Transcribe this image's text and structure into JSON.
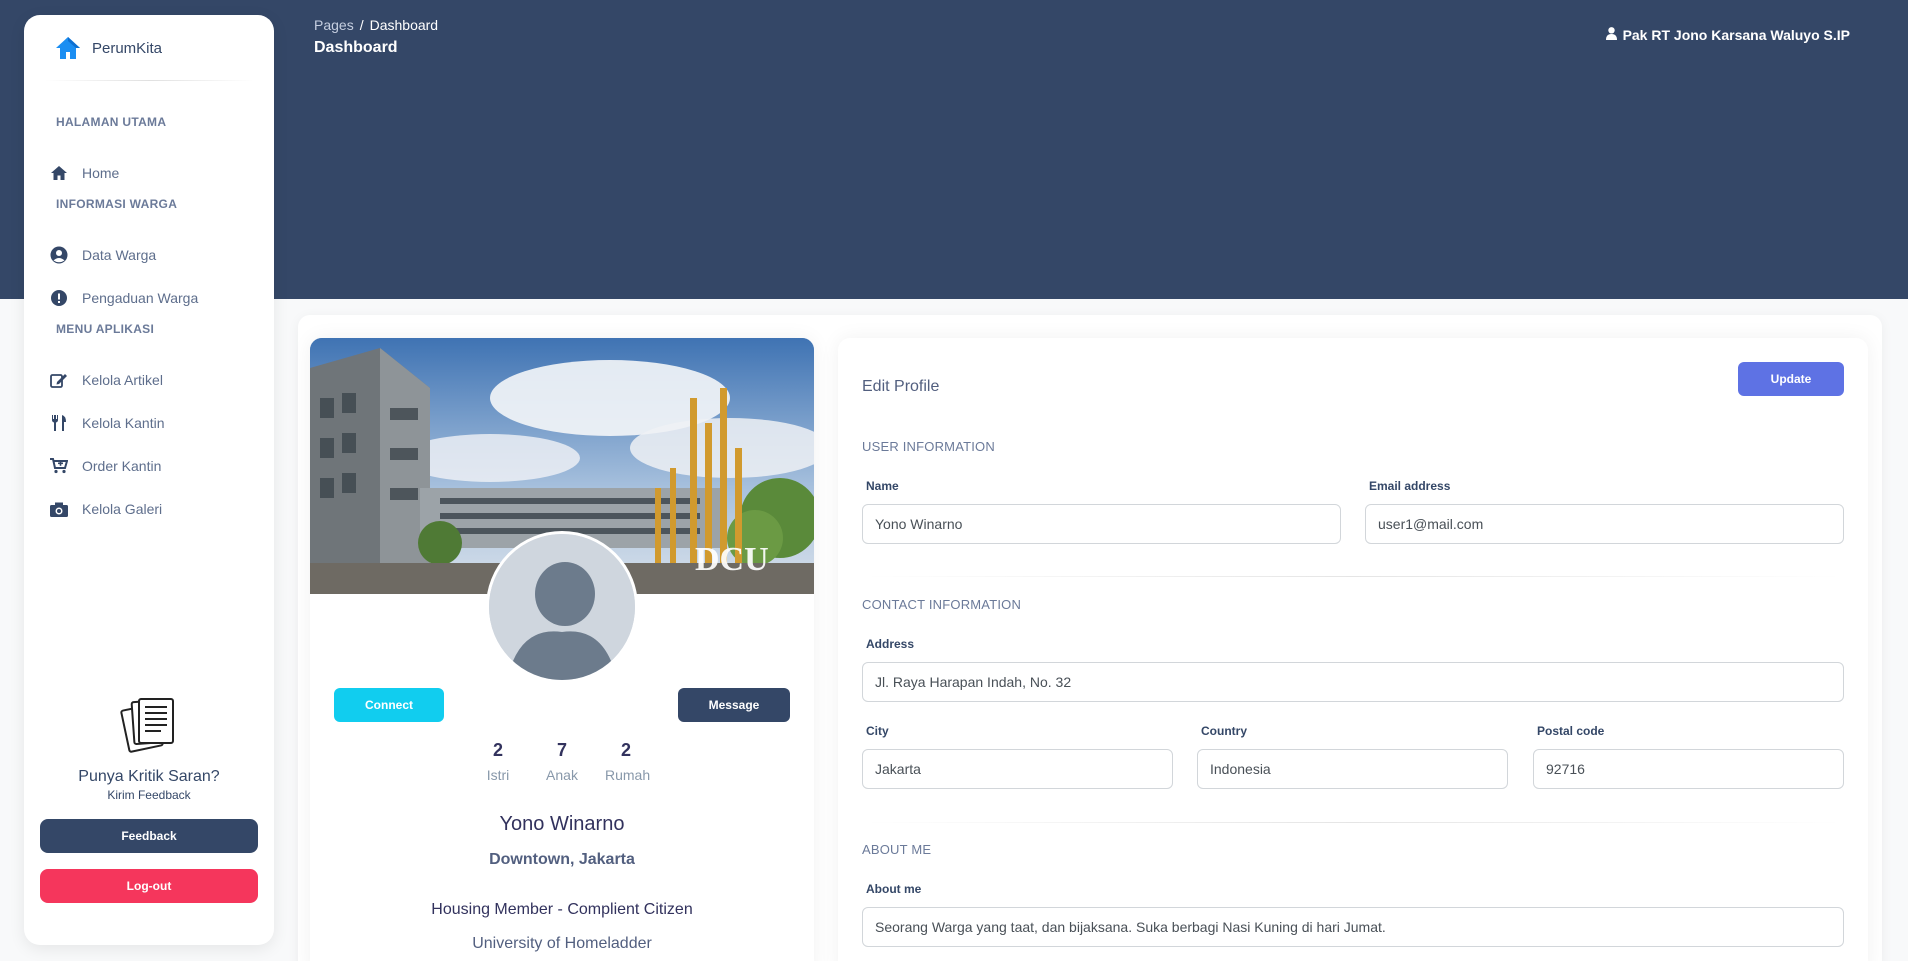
{
  "brand": {
    "name": "PerumKita",
    "icon": "house-icon"
  },
  "sidebar": {
    "sections": [
      {
        "title": "HALAMAN UTAMA"
      },
      {
        "title": "INFORMASI WARGA"
      },
      {
        "title": "MENU APLIKASI"
      }
    ],
    "items": [
      {
        "label": "Home",
        "icon": "home-icon"
      },
      {
        "label": "Data Warga",
        "icon": "user-circle-icon"
      },
      {
        "label": "Pengaduan Warga",
        "icon": "exclamation-circle-icon"
      },
      {
        "label": "Kelola Artikel",
        "icon": "edit-icon"
      },
      {
        "label": "Kelola Kantin",
        "icon": "utensils-icon"
      },
      {
        "label": "Order Kantin",
        "icon": "cart-icon"
      },
      {
        "label": "Kelola Galeri",
        "icon": "camera-icon"
      }
    ],
    "help": {
      "title": "Punya Kritik Saran?",
      "subtitle": "Kirim Feedback",
      "icon": "documents-icon"
    },
    "feedback_label": "Feedback",
    "logout_label": "Log-out"
  },
  "header": {
    "breadcrumb": {
      "root": "Pages",
      "separator": "/",
      "current": "Dashboard"
    },
    "title": "Dashboard",
    "user": "Pak RT Jono Karsana Waluyo S.IP"
  },
  "profile": {
    "cover_caption": "DCU",
    "connect_label": "Connect",
    "message_label": "Message",
    "stats": [
      {
        "value": "2",
        "label": "Istri"
      },
      {
        "value": "7",
        "label": "Anak"
      },
      {
        "value": "2",
        "label": "Rumah"
      }
    ],
    "name": "Yono Winarno",
    "location": "Downtown, Jakarta",
    "role": "Housing Member - Complient Citizen",
    "university": "University of Homeladder"
  },
  "edit": {
    "title": "Edit Profile",
    "update_label": "Update",
    "user_info": {
      "heading": "USER INFORMATION",
      "name_label": "Name",
      "name_value": "Yono Winarno",
      "email_label": "Email address",
      "email_value": "user1@mail.com"
    },
    "contact": {
      "heading": "CONTACT INFORMATION",
      "address_label": "Address",
      "address_value": "Jl. Raya Harapan Indah, No. 32",
      "city_label": "City",
      "city_value": "Jakarta",
      "country_label": "Country",
      "country_value": "Indonesia",
      "postal_label": "Postal code",
      "postal_value": "92716"
    },
    "about": {
      "heading": "ABOUT ME",
      "about_label": "About me",
      "about_value": "Seorang Warga yang taat, dan bijaksana. Suka berbagi Nasi Kuning di hari Jumat."
    }
  },
  "colors": {
    "header_bg": "#344767",
    "primary": "#5e72e4",
    "info": "#11cdef",
    "danger": "#f5365c",
    "dark": "#344767"
  }
}
